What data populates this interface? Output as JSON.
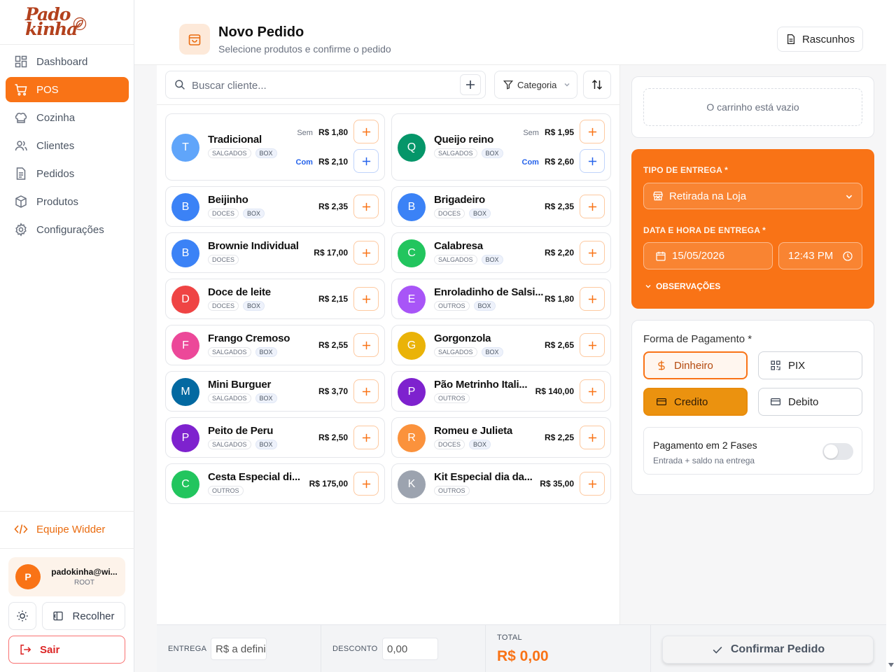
{
  "brand": {
    "line1": "Pado",
    "line2": "kinha"
  },
  "sidebar": {
    "items": [
      {
        "label": "Dashboard",
        "icon": "dashboard-icon"
      },
      {
        "label": "POS",
        "icon": "cart-icon"
      },
      {
        "label": "Cozinha",
        "icon": "chef-hat-icon"
      },
      {
        "label": "Clientes",
        "icon": "users-icon"
      },
      {
        "label": "Pedidos",
        "icon": "document-icon"
      },
      {
        "label": "Produtos",
        "icon": "package-icon"
      },
      {
        "label": "Configurações",
        "icon": "gear-icon"
      }
    ],
    "active": "POS",
    "team_label": "Equipe Widder",
    "user": {
      "initial": "P",
      "email": "padokinha@wi...",
      "role": "ROOT"
    },
    "collapse_label": "Recolher",
    "logout_label": "Sair"
  },
  "header": {
    "title": "Novo Pedido",
    "subtitle": "Selecione produtos e confirme o pedido",
    "drafts_label": "Rascunhos"
  },
  "toolbar": {
    "search_placeholder": "Buscar cliente...",
    "category_label": "Categoria"
  },
  "products": [
    {
      "name": "Tradicional",
      "initial": "T",
      "color": "#60a5fa",
      "tags": [
        "SALGADOS",
        "BOX"
      ],
      "variants": [
        {
          "label": "Sem",
          "price": "R$ 1,80"
        },
        {
          "label": "Com",
          "price": "R$ 2,10"
        }
      ]
    },
    {
      "name": "Queijo reino",
      "initial": "Q",
      "color": "#059669",
      "tags": [
        "SALGADOS",
        "BOX"
      ],
      "variants": [
        {
          "label": "Sem",
          "price": "R$ 1,95"
        },
        {
          "label": "Com",
          "price": "R$ 2,60"
        }
      ]
    },
    {
      "name": "Beijinho",
      "initial": "B",
      "color": "#3b82f6",
      "tags": [
        "DOCES",
        "BOX"
      ],
      "price": "R$ 2,35"
    },
    {
      "name": "Brigadeiro",
      "initial": "B",
      "color": "#3b82f6",
      "tags": [
        "DOCES",
        "BOX"
      ],
      "price": "R$ 2,35"
    },
    {
      "name": "Brownie Individual",
      "initial": "B",
      "color": "#3b82f6",
      "tags": [
        "DOCES"
      ],
      "price": "R$ 17,00"
    },
    {
      "name": "Calabresa",
      "initial": "C",
      "color": "#22c55e",
      "tags": [
        "SALGADOS",
        "BOX"
      ],
      "price": "R$ 2,20"
    },
    {
      "name": "Doce de leite",
      "initial": "D",
      "color": "#ef4444",
      "tags": [
        "DOCES",
        "BOX"
      ],
      "price": "R$ 2,15"
    },
    {
      "name": "Enroladinho de Salsi...",
      "initial": "E",
      "color": "#a855f7",
      "tags": [
        "OUTROS",
        "BOX"
      ],
      "price": "R$ 1,80"
    },
    {
      "name": "Frango Cremoso",
      "initial": "F",
      "color": "#ec4899",
      "tags": [
        "SALGADOS",
        "BOX"
      ],
      "price": "R$ 2,55"
    },
    {
      "name": "Gorgonzola",
      "initial": "G",
      "color": "#eab308",
      "tags": [
        "SALGADOS",
        "BOX"
      ],
      "price": "R$ 2,65"
    },
    {
      "name": "Mini Burguer",
      "initial": "M",
      "color": "#0369a1",
      "tags": [
        "SALGADOS",
        "BOX"
      ],
      "price": "R$ 3,70"
    },
    {
      "name": "Pão Metrinho Itali...",
      "initial": "P",
      "color": "#7e22ce",
      "tags": [
        "OUTROS"
      ],
      "price": "R$ 140,00"
    },
    {
      "name": "Peito de Peru",
      "initial": "P",
      "color": "#7e22ce",
      "tags": [
        "SALGADOS",
        "BOX"
      ],
      "price": "R$ 2,50"
    },
    {
      "name": "Romeu e Julieta",
      "initial": "R",
      "color": "#fb923c",
      "tags": [
        "DOCES",
        "BOX"
      ],
      "price": "R$ 2,25"
    },
    {
      "name": "Cesta Especial di...",
      "initial": "C",
      "color": "#22c55e",
      "tags": [
        "OUTROS"
      ],
      "price": "R$ 175,00"
    },
    {
      "name": "Kit Especial dia da...",
      "initial": "K",
      "color": "#9ca3af",
      "tags": [
        "OUTROS"
      ],
      "price": "R$ 35,00"
    }
  ],
  "cart": {
    "empty_text": "O carrinho está vazio"
  },
  "delivery": {
    "type_label": "TIPO DE ENTREGA *",
    "type_value": "Retirada na Loja",
    "datetime_label": "DATA E HORA DE ENTREGA *",
    "date": "15/05/2026",
    "time": "12:43 PM",
    "notes_label": "OBSERVAÇÕES"
  },
  "payment": {
    "title": "Forma de Pagamento *",
    "methods": [
      "Dinheiro",
      "PIX",
      "Credito",
      "Debito"
    ],
    "two_phase_title": "Pagamento em 2 Fases",
    "two_phase_sub": "Entrada + saldo na entrega",
    "two_phase_enabled": false
  },
  "footer": {
    "delivery_label": "ENTREGA",
    "delivery_value": "R$ a definir",
    "discount_label": "DESCONTO",
    "discount_value": "0,00",
    "total_label": "TOTAL",
    "total_value": "R$ 0,00",
    "confirm_label": "Confirmar Pedido"
  },
  "colors": {
    "accent": "#f97316",
    "brand": "#b3411d",
    "credit": "#eb920f"
  }
}
